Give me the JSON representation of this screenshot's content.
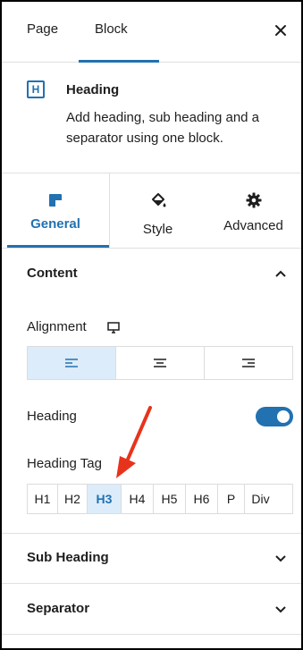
{
  "top_tabs": {
    "page": "Page",
    "block": "Block"
  },
  "block": {
    "icon_letter": "H",
    "title": "Heading",
    "description": "Add heading, sub heading and a separator using one block."
  },
  "settings_tabs": {
    "general": "General",
    "style": "Style",
    "advanced": "Advanced"
  },
  "content": {
    "title": "Content",
    "alignment_label": "Alignment",
    "heading_label": "Heading",
    "heading_toggle_on": true,
    "heading_tag_label": "Heading Tag",
    "tags": [
      "H1",
      "H2",
      "H3",
      "H4",
      "H5",
      "H6",
      "P",
      "Div"
    ],
    "active_tag": "H3"
  },
  "sections": {
    "sub_heading": "Sub Heading",
    "separator": "Separator"
  },
  "colors": {
    "accent": "#2271b1",
    "active_bg": "#dcecfa",
    "arrow": "#e8331c"
  }
}
